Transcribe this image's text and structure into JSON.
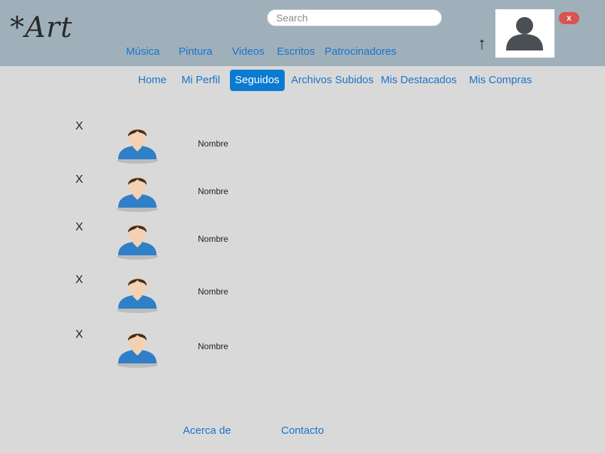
{
  "header": {
    "logo": "*Art",
    "search_placeholder": "Search",
    "nav": [
      "Música",
      "Pintura",
      "Videos",
      "Escritos",
      "Patrocinadores"
    ],
    "close_label": "x",
    "upload_arrow": "↑"
  },
  "subnav": {
    "items": [
      "Home",
      "Mi Perfil",
      "Seguidos",
      "Archivos Subidos",
      "Mis Destacados",
      "Mis Compras"
    ],
    "active": "Seguidos"
  },
  "followed": [
    {
      "remove": "X",
      "name": "Nombre"
    },
    {
      "remove": "X",
      "name": "Nombre"
    },
    {
      "remove": "X",
      "name": "Nombre"
    },
    {
      "remove": "X",
      "name": "Nombre"
    },
    {
      "remove": "X",
      "name": "Nombre"
    }
  ],
  "footer": {
    "links": [
      "Acerca de",
      "Contacto"
    ]
  },
  "colors": {
    "header_bg": "#9fb0bb",
    "page_bg": "#d9d9d9",
    "link": "#1a73c9",
    "active_tab": "#0a7bd0",
    "close_pill": "#d9534f"
  }
}
